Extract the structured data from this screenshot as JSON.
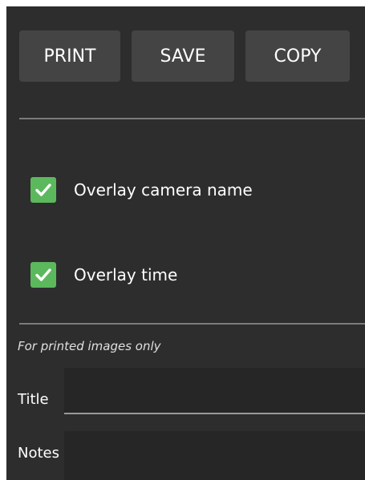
{
  "toolbar": {
    "print_label": "PRINT",
    "save_label": "SAVE",
    "copy_label": "COPY"
  },
  "options": {
    "overlay_camera_name": {
      "label": "Overlay camera name",
      "checked": true,
      "icon": "checkmark-icon"
    },
    "overlay_time": {
      "label": "Overlay time",
      "checked": true,
      "icon": "checkmark-icon"
    }
  },
  "print_section": {
    "hint": "For printed images only",
    "title_label": "Title",
    "title_value": "",
    "notes_label": "Notes",
    "notes_value": ""
  },
  "colors": {
    "background": "#2d2d2d",
    "button": "#444444",
    "checkbox": "#5cb85c",
    "divider": "#7b7b7b"
  }
}
